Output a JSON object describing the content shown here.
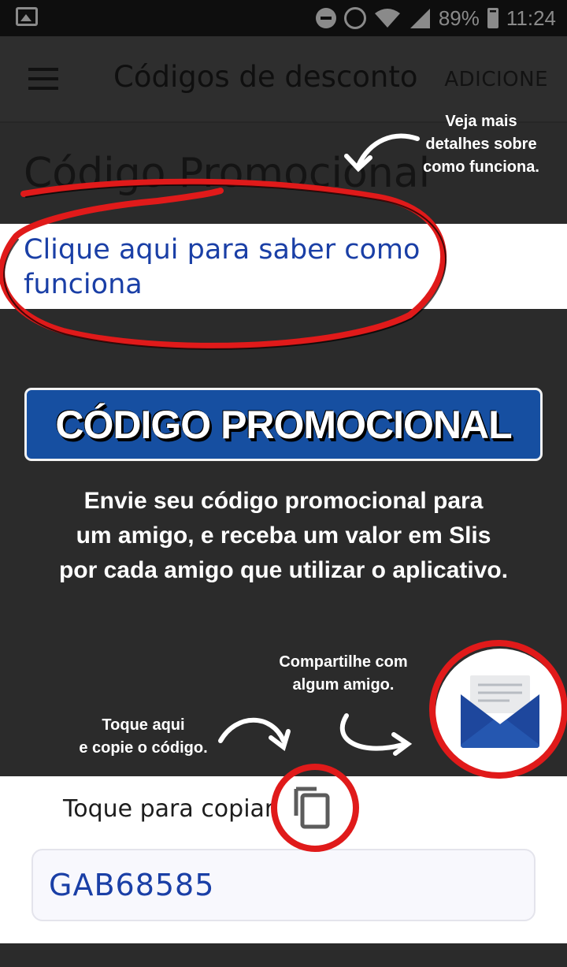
{
  "status_bar": {
    "battery": "89%",
    "time": "11:24",
    "icons": [
      "gallery-icon",
      "do-not-disturb-icon",
      "alarm-icon",
      "wifi-icon",
      "signal-icon",
      "battery-icon"
    ]
  },
  "app_bar": {
    "title": "Códigos de desconto",
    "action": "ADICIONE"
  },
  "section": {
    "title": "Código Promocional",
    "how_link": [
      "Clique aqui para saber como",
      "funciona"
    ]
  },
  "promo": {
    "banner": "CÓDIGO PROMOCIONAL",
    "description": [
      "Envie seu código promocional para",
      "um amigo, e receba um valor em Slis",
      "por cada amigo que utilizar o aplicativo."
    ]
  },
  "annotations": {
    "top": [
      "Veja mais",
      "detalhes sobre",
      "como funciona."
    ],
    "share": [
      "Compartilhe com",
      "algum amigo."
    ],
    "copy": [
      "Toque aqui",
      "e copie o código."
    ]
  },
  "copy_panel": {
    "label": "Toque para copiar",
    "code": "GAB68585"
  },
  "colors": {
    "accent_blue": "#1a3fa6",
    "banner_blue": "#164fa1",
    "highlight_red": "#e01a1a",
    "background": "#2b2b2b"
  }
}
